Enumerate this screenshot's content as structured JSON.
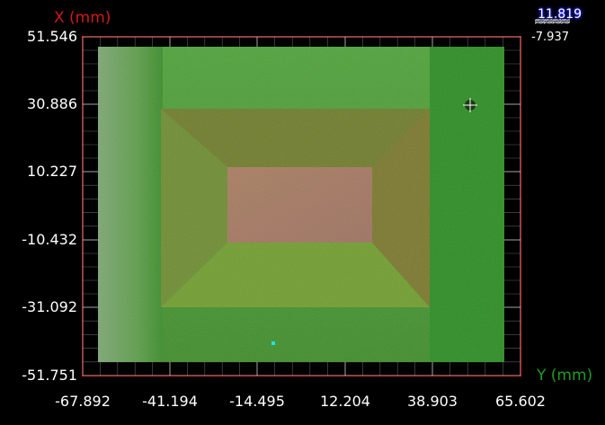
{
  "axes": {
    "x_title": "X (mm)",
    "y_title": "Y (mm)",
    "x_ticks": [
      "51.546",
      "30.886",
      "10.227",
      "-10.432",
      "-31.092",
      "-51.751"
    ],
    "y_ticks": [
      "-67.892",
      "-41.194",
      "-14.495",
      "12.204",
      "38.903",
      "65.602"
    ]
  },
  "legend": {
    "max": "11.819",
    "min": "-7.937"
  },
  "colors": {
    "frame": "#d42a2a",
    "grid": "#cfcfcf",
    "x_axis": "#d21919",
    "y_axis": "#1e9e1e",
    "marker": "#19e6e6",
    "surface_low": "#2f8a24",
    "surface_high": "#9c6c59"
  }
}
